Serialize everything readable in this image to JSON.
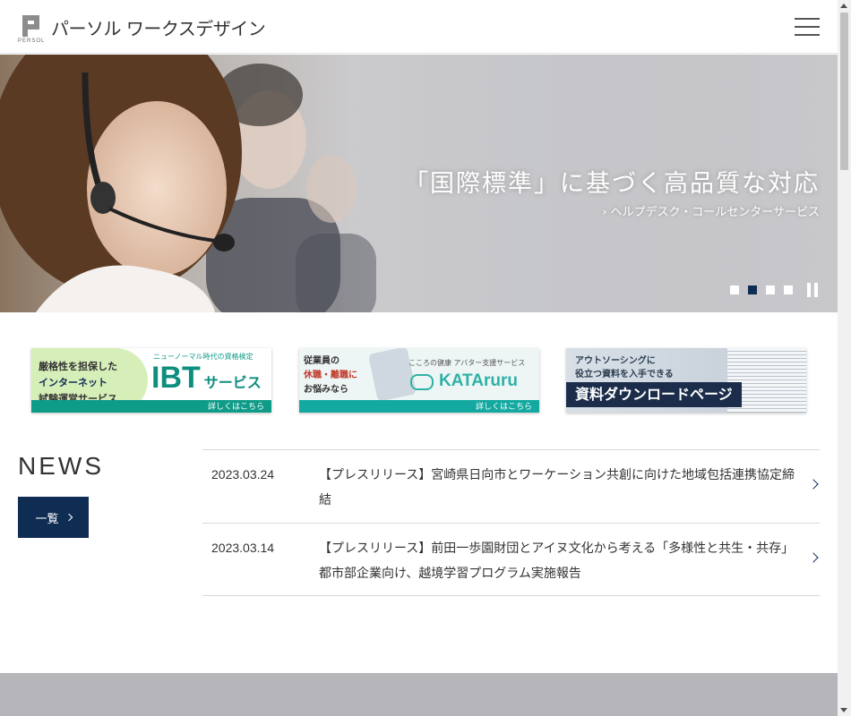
{
  "header": {
    "logo_text": "パーソル ワークスデザイン",
    "logo_sub": "PERSOL",
    "menu_icon": "hamburger-menu-icon"
  },
  "hero": {
    "title": "「国際標準」に基づく高品質な対応",
    "link": "› ヘルプデスク・コールセンターサービス",
    "slide_count": 4,
    "active_slide": 2
  },
  "banners": [
    {
      "lines": [
        "厳格性を担保した",
        "インターネット",
        "試験運営サービス"
      ],
      "tag": "ニューノーマル時代の資格検定",
      "brand": "IBT",
      "brand_suffix": "サービス",
      "more": "詳しくはこちら"
    },
    {
      "lines": [
        "従業員の",
        "休職・離職に",
        "お悩みなら"
      ],
      "tag": "こころの健康 アバター支援サービス",
      "brand": "KATAruru",
      "more": "詳しくはこちら"
    },
    {
      "lines": [
        "アウトソーシングに",
        "役立つ資料を入手できる"
      ],
      "cta": "資料ダウンロードページ"
    }
  ],
  "news": {
    "title": "NEWS",
    "all_button": "一覧",
    "items": [
      {
        "date": "2023.03.24",
        "text": "【プレスリリース】宮崎県日向市とワーケーション共創に向けた地域包括連携協定締結"
      },
      {
        "date": "2023.03.14",
        "text": "【プレスリリース】前田一歩園財団とアイヌ文化から考える「多様性と共生・共存」 都市部企業向け、越境学習プログラム実施報告"
      }
    ]
  },
  "colors": {
    "navy": "#0f2c53",
    "teal": "#0e9b88",
    "footer_band": "#b6b5ba"
  }
}
